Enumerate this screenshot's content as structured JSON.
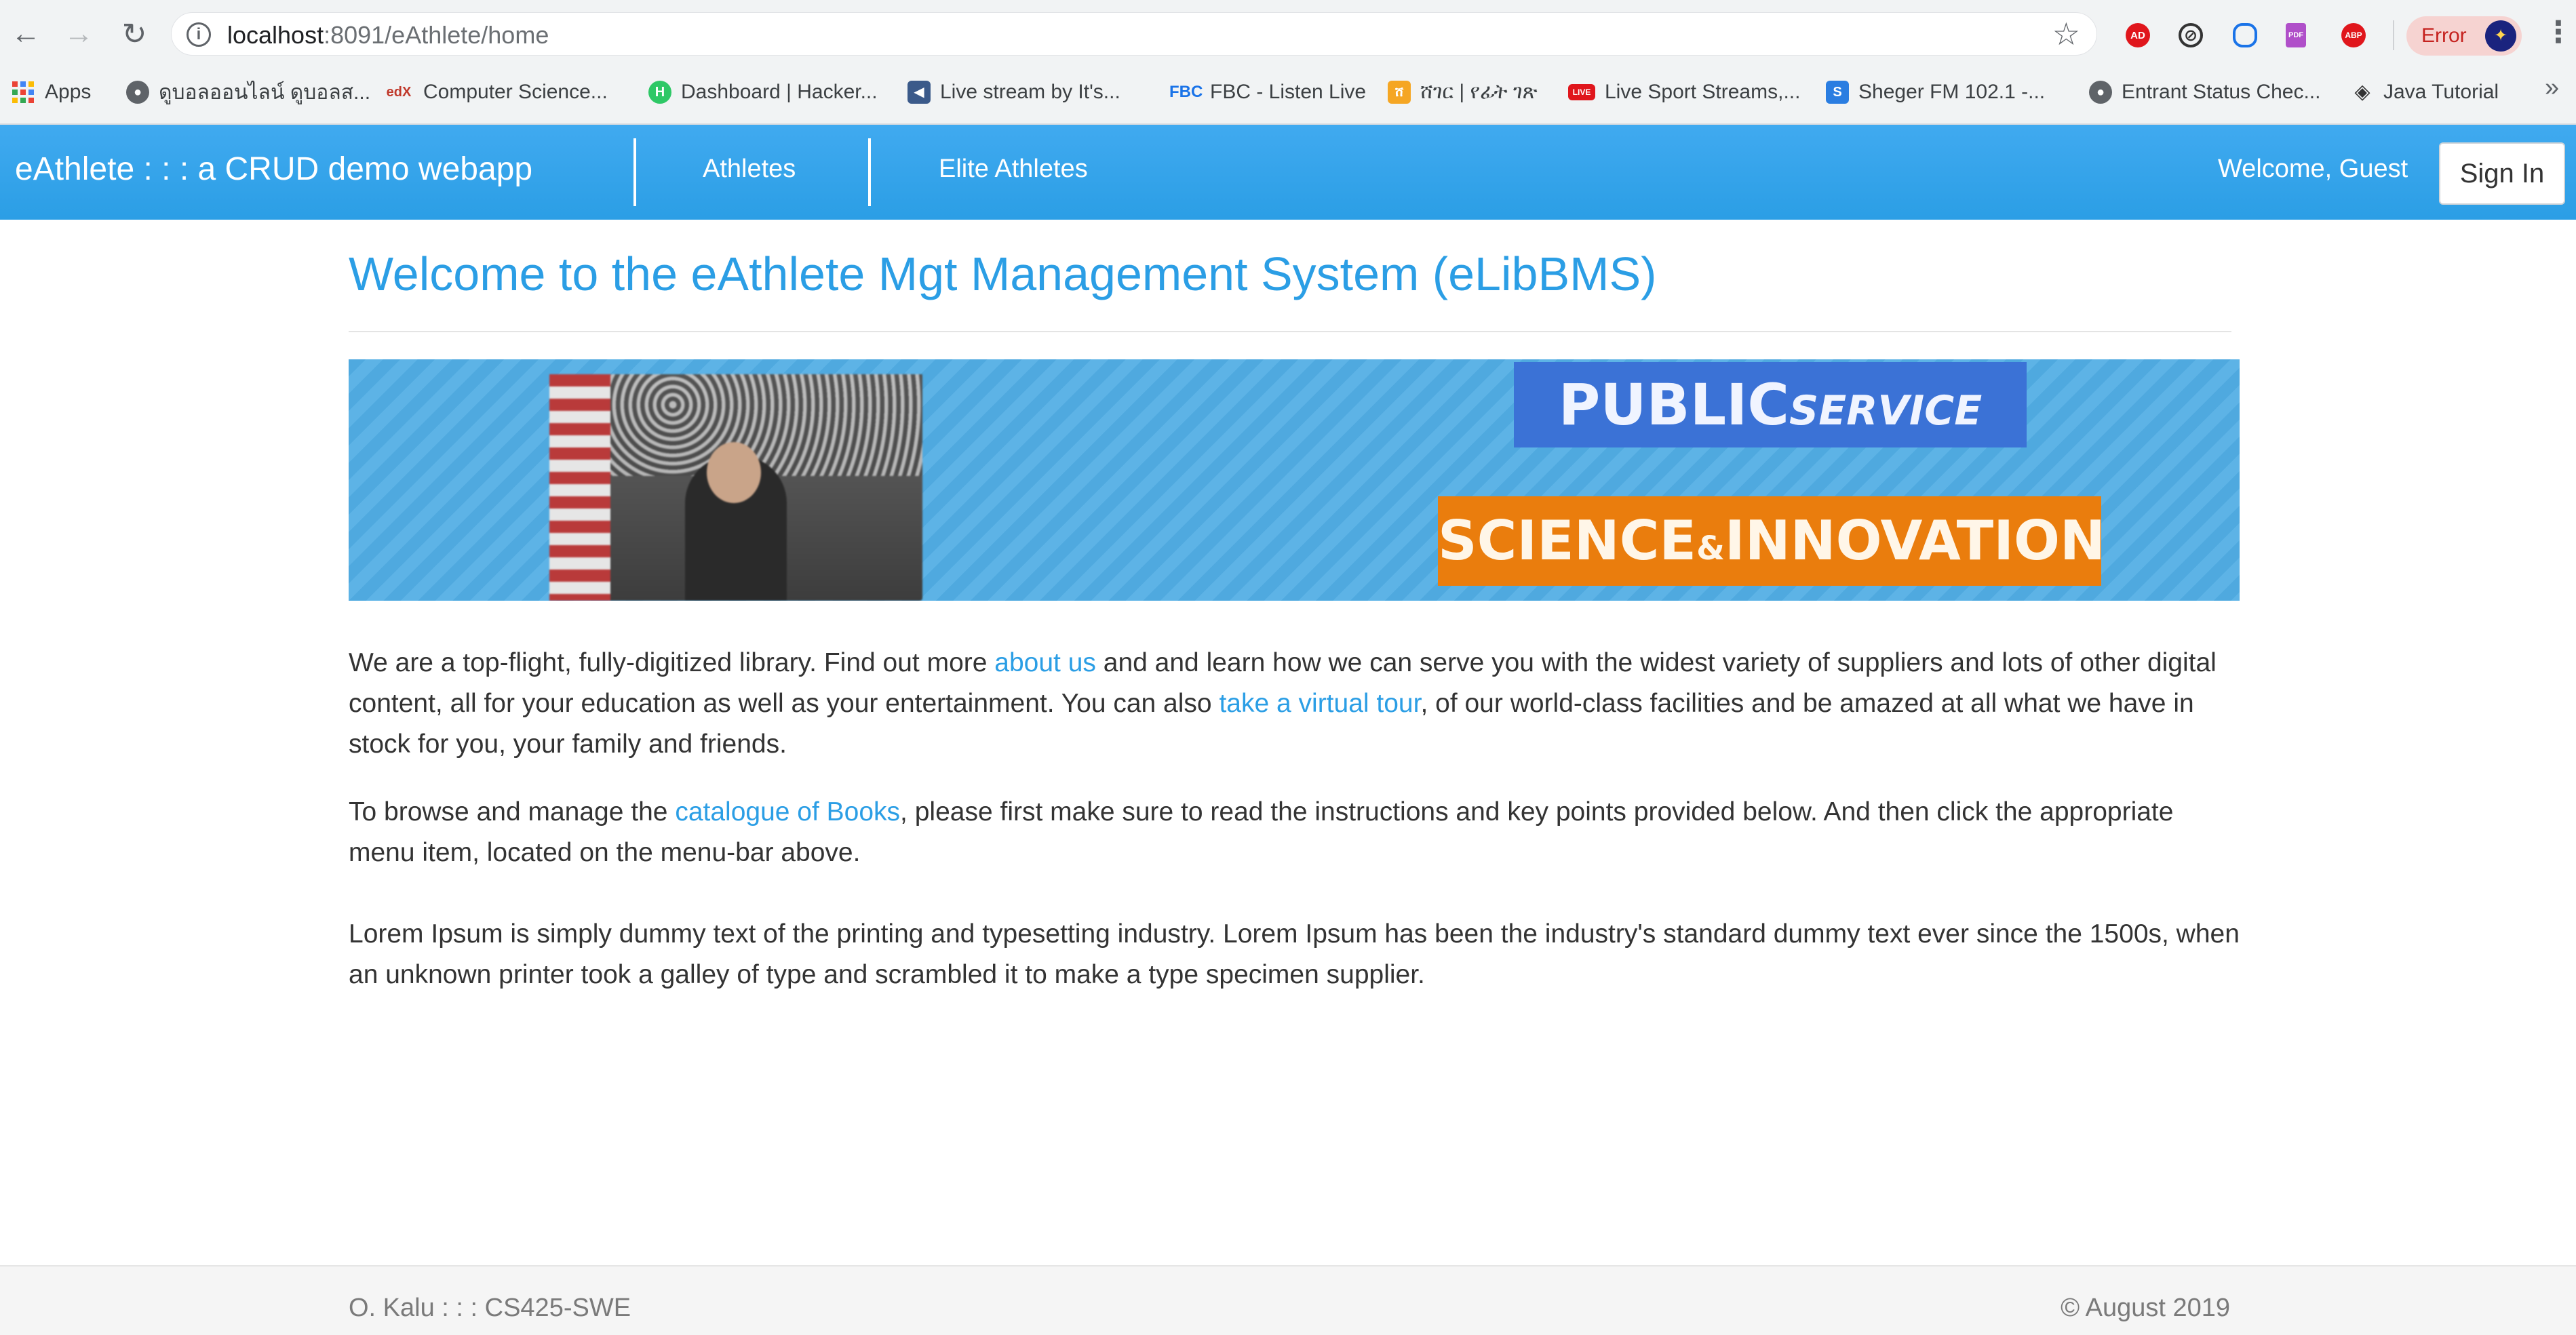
{
  "browser": {
    "url_host": "localhost",
    "url_rest": ":8091/eAthlete/home",
    "error_label": "Error",
    "bookmarks": [
      {
        "label": "Apps",
        "icon": "apps-grid-icon"
      },
      {
        "label": "ดูบอลออนไลน์ ดูบอลส...",
        "icon": "globe-icon"
      },
      {
        "label": "Computer Science...",
        "icon": "edx-icon"
      },
      {
        "label": "Dashboard | Hacker...",
        "icon": "hackerrank-icon"
      },
      {
        "label": "Live stream by It's...",
        "icon": "stream-icon"
      },
      {
        "label": "FBC - Listen Live",
        "icon": "fbc-icon"
      },
      {
        "label": "ሸገር | የፊት ገጽ",
        "icon": "sheger-icon"
      },
      {
        "label": "Live Sport Streams,...",
        "icon": "live-icon"
      },
      {
        "label": "Sheger FM 102.1 -...",
        "icon": "s-icon"
      },
      {
        "label": "Entrant Status Chec...",
        "icon": "globe-icon"
      },
      {
        "label": "Java Tutorial",
        "icon": "java-icon"
      }
    ],
    "bookmark_fbc_mark": "FBC",
    "bookmark_edx_mark": "edX",
    "bookmark_live_mark": "LIVE",
    "bookmark_s_mark": "S",
    "bookmark_h_mark": "H",
    "bookmark_g_mark": "ሸ",
    "ext_ad_mark": "AD",
    "ext_abp_mark": "ABP",
    "ext_pdf_mark": "PDF",
    "more_mark": "»"
  },
  "navbar": {
    "brand": "eAthlete : : : a CRUD demo webapp",
    "links": [
      "Athletes",
      "Elite Athletes"
    ],
    "welcome": "Welcome, Guest",
    "signin": "Sign In"
  },
  "main": {
    "title": "Welcome to the eAthlete Mgt Management System (eLibBMS)",
    "banner": {
      "public_big": "PUBLIC",
      "public_small": "SERVICE",
      "sci_a": "SCIENCE",
      "sci_amp": "&",
      "sci_b": "INNOVATION"
    },
    "p1": {
      "a": "We are a top-flight, fully-digitized library. Find out more ",
      "link1": "about us",
      "b": " and and learn how we can serve you with the widest variety of suppliers and lots of other digital content, all for your education as well as your entertainment. You can also ",
      "link2": "take a virtual tour",
      "c": ", of our world-class facilities and be amazed at all what we have in stock for you, your family and friends."
    },
    "p2": {
      "a": "To browse and manage the ",
      "link": "catalogue of Books",
      "b": ", please first make sure to read the instructions and key points provided below. And then click the appropriate menu item, located on the menu-bar above."
    },
    "p3": "Lorem Ipsum is simply dummy text of the printing and typesetting industry. Lorem Ipsum has been the industry's standard dummy text ever since the 1500s, when an unknown printer took a galley of type and scrambled it to make a type specimen supplier."
  },
  "footer": {
    "left": "O. Kalu : : : CS425-SWE",
    "right": "© August 2019"
  },
  "colors": {
    "navbar": "#2b9ee5",
    "link": "#2b9ee5",
    "title": "#2b9ee5",
    "banner_public_box": "#3b72d6",
    "banner_science_box": "#ea7d0d"
  }
}
